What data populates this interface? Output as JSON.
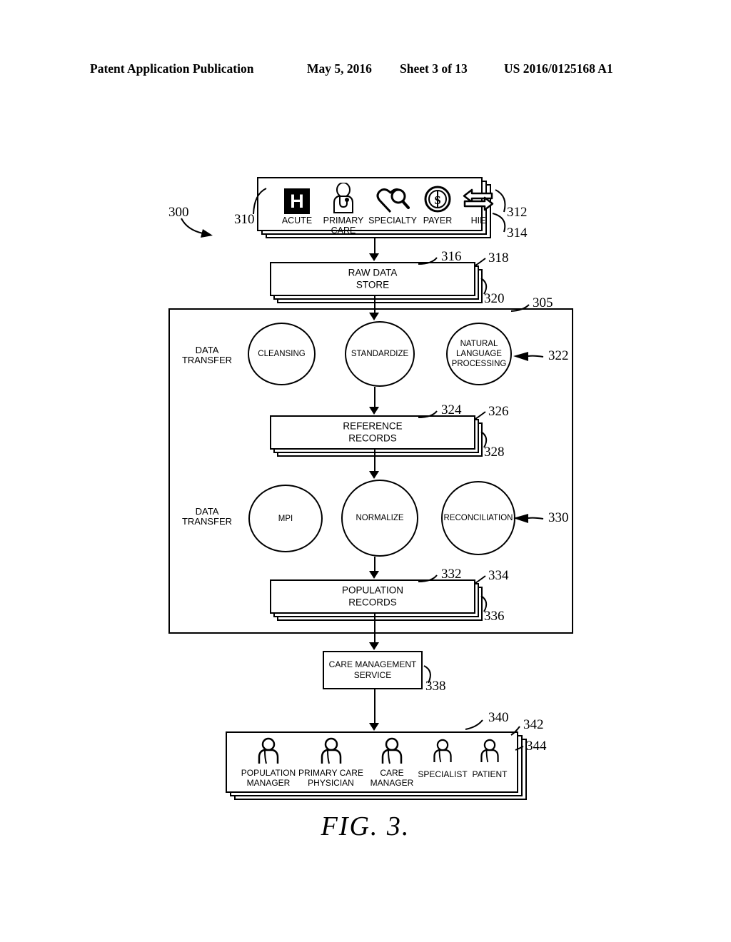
{
  "header": {
    "publication": "Patent Application Publication",
    "date": "May 5, 2016",
    "sheet": "Sheet 3 of 13",
    "patent_number": "US 2016/0125168 A1"
  },
  "figure_caption": "FIG. 3.",
  "refs": {
    "r300": "300",
    "r305": "305",
    "r310": "310",
    "r312": "312",
    "r314": "314",
    "r316": "316",
    "r318": "318",
    "r320": "320",
    "r322": "322",
    "r324": "324",
    "r326": "326",
    "r328": "328",
    "r330": "330",
    "r332": "332",
    "r334": "334",
    "r336": "336",
    "r338": "338",
    "r340": "340",
    "r342": "342",
    "r344": "344"
  },
  "sources": {
    "items": [
      {
        "label": "ACUTE",
        "icon": "hospital-h-icon"
      },
      {
        "label": "PRIMARY\nCARE",
        "icon": "physician-stethoscope-icon"
      },
      {
        "label": "SPECIALTY",
        "icon": "heart-magnifier-icon"
      },
      {
        "label": "PAYER",
        "icon": "dollar-coin-icon"
      },
      {
        "label": "HIE",
        "icon": "exchange-arrows-icon"
      }
    ]
  },
  "raw_data_store": {
    "label": "RAW DATA\nSTORE"
  },
  "container": {
    "transfer_label_top": "DATA\nTRANSFER",
    "transfer_label_bottom": "DATA\nTRANSFER",
    "process_row_1": [
      {
        "label": "CLEANSING"
      },
      {
        "label": "STANDARDIZE"
      },
      {
        "label": "NATURAL\nLANGUAGE\nPROCESSING"
      }
    ],
    "reference_records": {
      "label": "REFERENCE\nRECORDS"
    },
    "process_row_2": [
      {
        "label": "MPI"
      },
      {
        "label": "NORMALIZE"
      },
      {
        "label": "RECONCILIATION"
      }
    ],
    "population_records": {
      "label": "POPULATION\nRECORDS"
    }
  },
  "care_management_service": {
    "label": "CARE MANAGEMENT\nSERVICE"
  },
  "users": {
    "items": [
      {
        "label": "POPULATION\nMANAGER",
        "icon": "person-icon"
      },
      {
        "label": "PRIMARY CARE\nPHYSICIAN",
        "icon": "person-icon"
      },
      {
        "label": "CARE\nMANAGER",
        "icon": "person-icon"
      },
      {
        "label": "SPECIALIST",
        "icon": "person-icon"
      },
      {
        "label": "PATIENT",
        "icon": "person-icon"
      }
    ]
  }
}
